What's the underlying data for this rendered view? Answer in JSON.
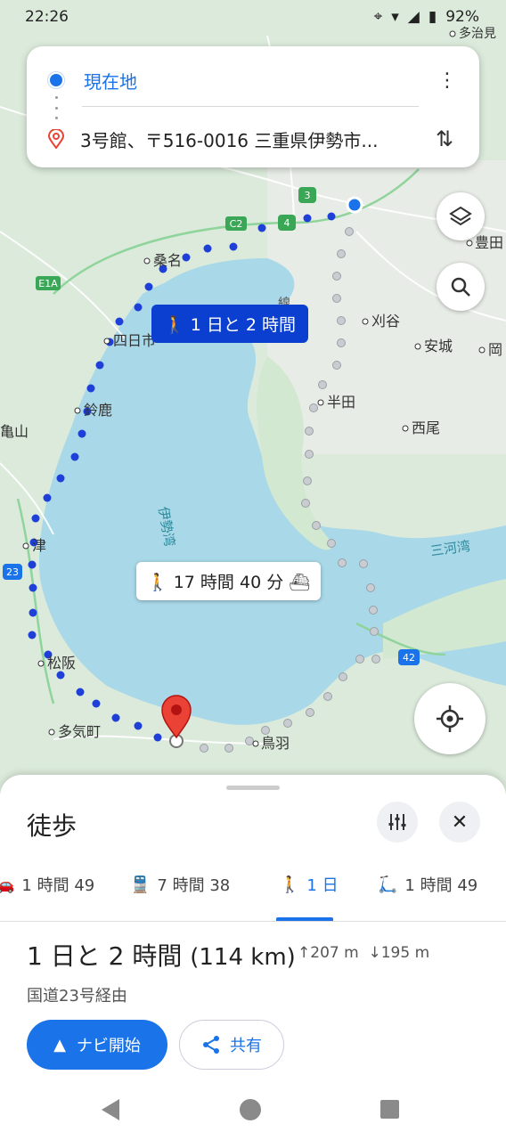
{
  "status_bar": {
    "time": "22:26",
    "battery": "92%"
  },
  "route_card": {
    "from": "現在地",
    "to": "3号館、〒516-0016 三重県伊勢市..."
  },
  "map": {
    "labels": {
      "kuwana": "桑名",
      "yokkaichi": "四日市",
      "suzuka": "鈴鹿",
      "kameyama": "亀山",
      "tsu": "津",
      "matsusaka": "松阪",
      "taki": "多気町",
      "toba": "鳥羽",
      "handa": "半田",
      "kariya": "刈谷",
      "anjo": "安城",
      "nishio": "西尾",
      "toyota": "豊田",
      "oka": "岡",
      "tajimi": "多治見",
      "isewan": "伊勢湾",
      "mikawawan": "三河湾",
      "sen": "線",
      "road_c2": "C2",
      "road_3": "3",
      "road_4": "4",
      "road_e1a": "E1A",
      "road_23": "23",
      "road_42": "42"
    },
    "route_label_selected": "1 日と 2 時間",
    "route_label_alt": "17 時間 40 分"
  },
  "sheet": {
    "mode_title": "徒歩",
    "tabs": [
      {
        "icon": "car-icon",
        "label": "1 時間 49"
      },
      {
        "icon": "train-icon",
        "label": "7 時間 38"
      },
      {
        "icon": "walk-icon",
        "label": "1 日"
      },
      {
        "icon": "ride-icon",
        "label": "1 時間 49"
      }
    ],
    "summary_time": "1 日と 2 時間",
    "summary_distance": "(114 km)",
    "ascent": "207 m",
    "descent": "195 m",
    "via": "国道23号経由",
    "nav_label": "ナビ開始",
    "share_label": "共有"
  },
  "colors": {
    "accent": "#1a73e8",
    "route": "#1e40d9",
    "water": "#a9d8e8",
    "land": "#dcebdc"
  }
}
